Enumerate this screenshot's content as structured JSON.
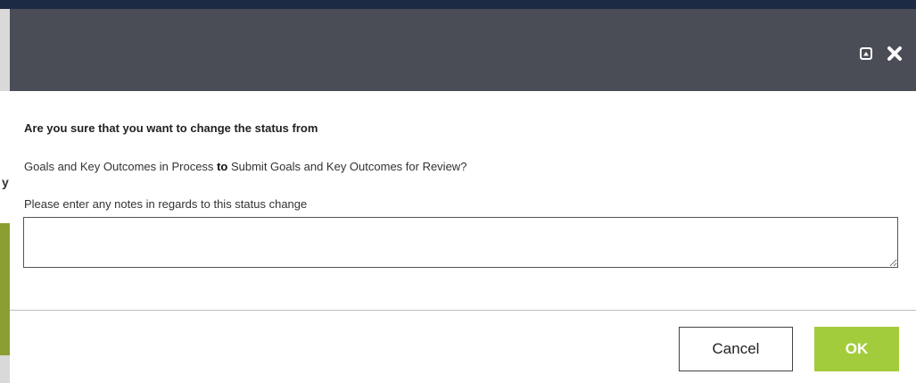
{
  "dialog": {
    "question": "Are you sure that you want to change the status from",
    "from_status": "Goals and Key Outcomes in Process",
    "connector": "to",
    "to_status": "Submit Goals and Key Outcomes for Review?",
    "notes_label": "Please enter any notes in regards to this status change",
    "notes_value": "",
    "header_icons": [
      "maximize-icon",
      "close-icon"
    ]
  },
  "footer": {
    "cancel_label": "Cancel",
    "ok_label": "OK"
  },
  "colors": {
    "header_bg": "#4a4c56",
    "ok_bg": "#a3cc3c",
    "page_top": "#1c2a44",
    "bg_green": "#8a9e32"
  },
  "background": {
    "glyph": "y"
  }
}
